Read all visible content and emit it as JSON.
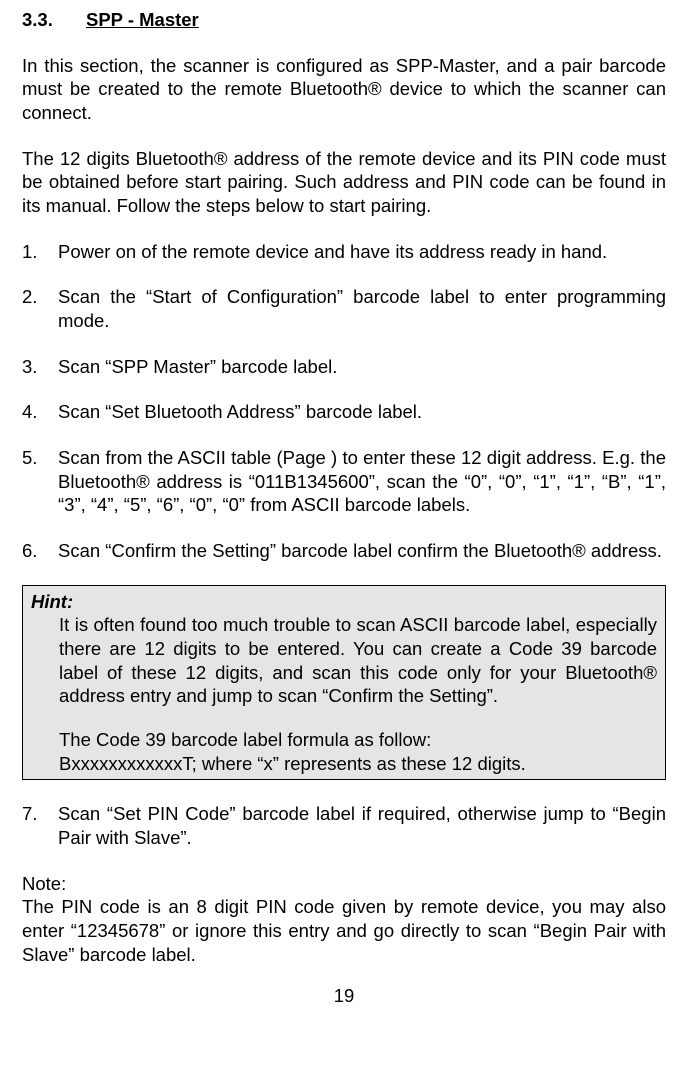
{
  "section_number": "3.3.",
  "section_title": "SPP - Master",
  "intro_p1": "In this section, the scanner is configured as SPP-Master, and a pair barcode must be created to the remote Bluetooth® device to which the scanner can connect.",
  "intro_p2": "The 12 digits Bluetooth® address of the remote device and its PIN code must be obtained before start pairing. Such address and PIN code can be found in its manual. Follow the steps below to start pairing.",
  "steps": [
    {
      "num": "1.",
      "text": "Power on of the remote device and have its address ready in hand."
    },
    {
      "num": "2.",
      "text": "Scan the “Start of Configuration” barcode label to enter programming mode."
    },
    {
      "num": "3.",
      "text": "Scan “SPP Master” barcode label."
    },
    {
      "num": "4.",
      "text": "Scan “Set Bluetooth Address” barcode label."
    },
    {
      "num": "5.",
      "text": "Scan from the ASCII table (Page ) to enter these 12 digit address. E.g. the Bluetooth® address is “011B1345600”, scan the “0”, “0”, “1”, “1”, “B”, “1”, “3”, “4”, “5”, “6”, “0”, “0” from ASCII barcode labels."
    },
    {
      "num": "6.",
      "text": "Scan “Confirm the Setting” barcode label confirm the Bluetooth® address."
    }
  ],
  "hint": {
    "title": "Hint:",
    "body1": "It is often found too much trouble to scan ASCII barcode label, especially there are 12 digits to be entered.  You can create a Code 39 barcode label of these 12 digits, and scan this code only for your Bluetooth® address entry and jump to scan “Confirm the Setting”.",
    "body2a": "The Code 39 barcode label formula as follow:",
    "body2b": "BxxxxxxxxxxxxT; where “x” represents as these 12 digits."
  },
  "step7": {
    "num": "7.",
    "text": "Scan “Set PIN Code” barcode label if required, otherwise jump to “Begin Pair with Slave”."
  },
  "note_label": "Note:",
  "note_text": "The PIN code is an 8 digit PIN code given by remote device, you may also enter “12345678” or ignore this entry and go directly to scan “Begin Pair with Slave” barcode label.",
  "page_number": "19"
}
